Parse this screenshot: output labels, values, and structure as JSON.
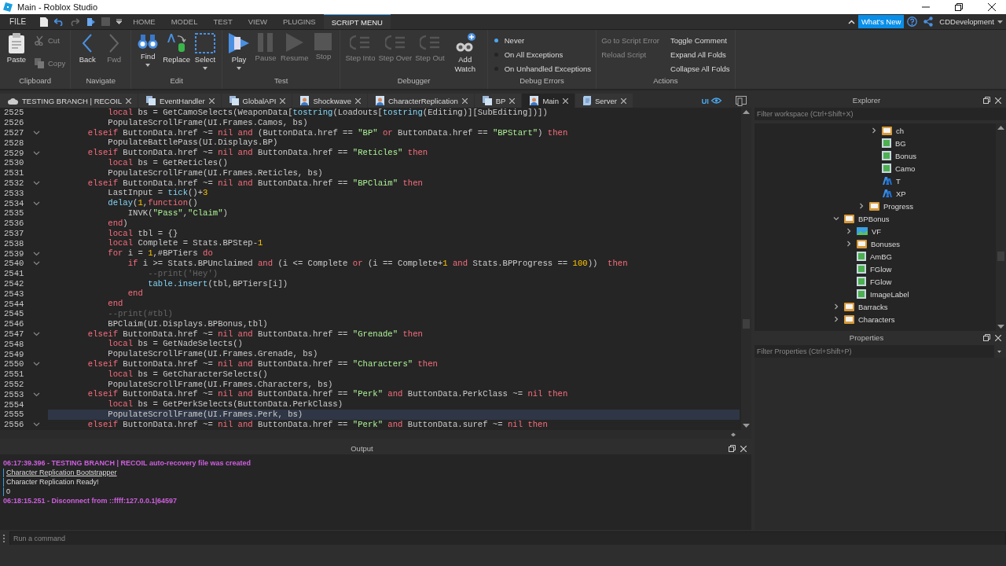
{
  "window": {
    "title": "Main - Roblox Studio"
  },
  "menu_bar": {
    "file": "FILE",
    "tabs": [
      {
        "label": "HOME",
        "selected": false
      },
      {
        "label": "MODEL",
        "selected": false
      },
      {
        "label": "TEST",
        "selected": false
      },
      {
        "label": "VIEW",
        "selected": false
      },
      {
        "label": "PLUGINS",
        "selected": false
      },
      {
        "label": "SCRIPT MENU",
        "selected": true
      }
    ],
    "whats_new": "What's New",
    "user": "CDDevelopment"
  },
  "ribbon": [
    {
      "label": "Clipboard",
      "items": [
        {
          "kind": "large",
          "label": "Paste",
          "disabled": false
        },
        {
          "kind": "small",
          "label": "Cut",
          "disabled": true
        },
        {
          "kind": "small",
          "label": "Copy",
          "disabled": true
        }
      ]
    },
    {
      "label": "Navigate",
      "items": [
        {
          "kind": "large",
          "label": "Back",
          "disabled": false
        },
        {
          "kind": "large",
          "label": "Fwd",
          "disabled": true
        }
      ]
    },
    {
      "label": "Edit",
      "items": [
        {
          "kind": "large",
          "label": "Find",
          "disabled": false,
          "dropdown": true
        },
        {
          "kind": "large",
          "label": "Replace",
          "disabled": false,
          "dropdown": false
        },
        {
          "kind": "large",
          "label": "Select",
          "disabled": false,
          "dropdown": true
        }
      ]
    },
    {
      "label": "Test",
      "items": [
        {
          "kind": "large",
          "label": "Play",
          "disabled": false,
          "dropdown": true
        },
        {
          "kind": "large",
          "label": "Pause",
          "disabled": true
        },
        {
          "kind": "large",
          "label": "Resume",
          "disabled": true
        },
        {
          "kind": "large",
          "label": "Stop",
          "disabled": true
        }
      ]
    },
    {
      "label": "Debugger",
      "items": [
        {
          "kind": "large",
          "label": "Step Into",
          "disabled": true
        },
        {
          "kind": "large",
          "label": "Step Over",
          "disabled": true
        },
        {
          "kind": "large",
          "label": "Step Out",
          "disabled": true
        },
        {
          "kind": "large",
          "label": "Add Watch",
          "disabled": false
        }
      ]
    },
    {
      "label": "Debug Errors",
      "items": [
        {
          "kind": "radio",
          "label": "Never",
          "selected": true
        },
        {
          "kind": "radio",
          "label": "On All Exceptions",
          "selected": false
        },
        {
          "kind": "radio",
          "label": "On Unhandled Exceptions",
          "selected": false
        }
      ]
    },
    {
      "label": "Actions",
      "items": [
        {
          "kind": "link",
          "label": "Go to Script Error",
          "disabled": true
        },
        {
          "kind": "link",
          "label": "Reload Script",
          "disabled": true
        },
        {
          "kind": "link",
          "label": "Toggle Comment",
          "disabled": false
        },
        {
          "kind": "link",
          "label": "Expand All Folds",
          "disabled": false
        },
        {
          "kind": "link",
          "label": "Collapse All Folds",
          "disabled": false
        }
      ]
    }
  ],
  "doc_tabs": [
    {
      "label": "TESTING BRANCH | RECOIL",
      "selected": false
    },
    {
      "label": "EventHandler",
      "selected": false
    },
    {
      "label": "GlobalAPI",
      "selected": false
    },
    {
      "label": "Shockwave",
      "selected": false
    },
    {
      "label": "CharacterReplication",
      "selected": false
    },
    {
      "label": "BP",
      "selected": false
    },
    {
      "label": "Main",
      "selected": true
    },
    {
      "label": "Server",
      "selected": false
    }
  ],
  "ui_toggle": "UI",
  "code": {
    "lines": [
      {
        "number": "2525",
        "fold": false,
        "selected": false,
        "tokens": [
          {
            "kind": "kw",
            "text": "            local"
          },
          {
            "kind": "p",
            "text": " bs = GetCamoSelects(WeaponData["
          },
          {
            "kind": "bi",
            "text": "tostring"
          },
          {
            "kind": "p",
            "text": "(Loadouts["
          },
          {
            "kind": "bi",
            "text": "tostring"
          },
          {
            "kind": "p",
            "text": "(Editing)][SubEditing])])"
          }
        ]
      },
      {
        "number": "2526",
        "fold": false,
        "selected": false,
        "tokens": [
          {
            "kind": "p",
            "text": "            PopulateScrollFrame(UI.Frames.Camos, bs)"
          }
        ]
      },
      {
        "number": "2527",
        "fold": true,
        "selected": false,
        "tokens": [
          {
            "kind": "kw",
            "text": "        elseif"
          },
          {
            "kind": "p",
            "text": " ButtonData.href ~= "
          },
          {
            "kind": "kw",
            "text": "nil and"
          },
          {
            "kind": "p",
            "text": " (ButtonData.href == "
          },
          {
            "kind": "st",
            "text": "\"BP\""
          },
          {
            "kind": "kw",
            "text": " or"
          },
          {
            "kind": "p",
            "text": " ButtonData.href == "
          },
          {
            "kind": "st",
            "text": "\"BPStart\""
          },
          {
            "kind": "p",
            "text": ") "
          },
          {
            "kind": "kw",
            "text": "then"
          }
        ]
      },
      {
        "number": "2528",
        "fold": false,
        "selected": false,
        "tokens": [
          {
            "kind": "p",
            "text": "            PopulateBattlePass(UI.Displays.BP)"
          }
        ]
      },
      {
        "number": "2529",
        "fold": true,
        "selected": false,
        "tokens": [
          {
            "kind": "kw",
            "text": "        elseif"
          },
          {
            "kind": "p",
            "text": " ButtonData.href ~= "
          },
          {
            "kind": "kw",
            "text": "nil and"
          },
          {
            "kind": "p",
            "text": " ButtonData.href == "
          },
          {
            "kind": "st",
            "text": "\"Reticles\""
          },
          {
            "kind": "kw",
            "text": " then"
          }
        ]
      },
      {
        "number": "2530",
        "fold": false,
        "selected": false,
        "tokens": [
          {
            "kind": "kw",
            "text": "            local"
          },
          {
            "kind": "p",
            "text": " bs = GetReticles()"
          }
        ]
      },
      {
        "number": "2531",
        "fold": false,
        "selected": false,
        "tokens": [
          {
            "kind": "p",
            "text": "            PopulateScrollFrame(UI.Frames.Reticles, bs)"
          }
        ]
      },
      {
        "number": "2532",
        "fold": true,
        "selected": false,
        "tokens": [
          {
            "kind": "kw",
            "text": "        elseif"
          },
          {
            "kind": "p",
            "text": " ButtonData.href ~= "
          },
          {
            "kind": "kw",
            "text": "nil and"
          },
          {
            "kind": "p",
            "text": " ButtonData.href == "
          },
          {
            "kind": "st",
            "text": "\"BPClaim\""
          },
          {
            "kind": "kw",
            "text": " then"
          }
        ]
      },
      {
        "number": "2533",
        "fold": false,
        "selected": false,
        "tokens": [
          {
            "kind": "p",
            "text": "            LastInput = "
          },
          {
            "kind": "bi",
            "text": "tick"
          },
          {
            "kind": "p",
            "text": "()+"
          },
          {
            "kind": "nu",
            "text": "3"
          }
        ]
      },
      {
        "number": "2534",
        "fold": true,
        "selected": false,
        "tokens": [
          {
            "kind": "bi",
            "text": "            delay"
          },
          {
            "kind": "p",
            "text": "("
          },
          {
            "kind": "nu",
            "text": "1"
          },
          {
            "kind": "p",
            "text": ","
          },
          {
            "kind": "kw",
            "text": "function"
          },
          {
            "kind": "p",
            "text": "()"
          }
        ]
      },
      {
        "number": "2535",
        "fold": false,
        "selected": false,
        "tokens": [
          {
            "kind": "p",
            "text": "                INVK("
          },
          {
            "kind": "st",
            "text": "\"Pass\""
          },
          {
            "kind": "p",
            "text": ","
          },
          {
            "kind": "st",
            "text": "\"Claim\""
          },
          {
            "kind": "p",
            "text": ")"
          }
        ]
      },
      {
        "number": "2536",
        "fold": false,
        "selected": false,
        "tokens": [
          {
            "kind": "kw",
            "text": "            end"
          },
          {
            "kind": "p",
            "text": ")"
          }
        ]
      },
      {
        "number": "2537",
        "fold": false,
        "selected": false,
        "tokens": [
          {
            "kind": "kw",
            "text": "            local"
          },
          {
            "kind": "p",
            "text": " tbl = {}"
          }
        ]
      },
      {
        "number": "2538",
        "fold": false,
        "selected": false,
        "tokens": [
          {
            "kind": "kw",
            "text": "            local"
          },
          {
            "kind": "p",
            "text": " Complete = Stats.BPStep-"
          },
          {
            "kind": "nu",
            "text": "1"
          }
        ]
      },
      {
        "number": "2539",
        "fold": true,
        "selected": false,
        "tokens": [
          {
            "kind": "kw",
            "text": "            for"
          },
          {
            "kind": "p",
            "text": " i = "
          },
          {
            "kind": "nu",
            "text": "1"
          },
          {
            "kind": "p",
            "text": ",#BPTiers "
          },
          {
            "kind": "kw",
            "text": "do"
          }
        ]
      },
      {
        "number": "2540",
        "fold": true,
        "selected": false,
        "tokens": [
          {
            "kind": "kw",
            "text": "                if"
          },
          {
            "kind": "p",
            "text": " i >= Stats.BPUnclaimed "
          },
          {
            "kind": "kw",
            "text": "and"
          },
          {
            "kind": "p",
            "text": " (i <= Complete "
          },
          {
            "kind": "kw",
            "text": "or"
          },
          {
            "kind": "p",
            "text": " (i == Complete+"
          },
          {
            "kind": "nu",
            "text": "1"
          },
          {
            "kind": "kw",
            "text": " and"
          },
          {
            "kind": "p",
            "text": " Stats.BPProgress == "
          },
          {
            "kind": "nu",
            "text": "100"
          },
          {
            "kind": "p",
            "text": "))  "
          },
          {
            "kind": "kw",
            "text": "then"
          }
        ]
      },
      {
        "number": "2541",
        "fold": false,
        "selected": false,
        "tokens": [
          {
            "kind": "cm",
            "text": "                    --print('Hey')"
          }
        ]
      },
      {
        "number": "2542",
        "fold": false,
        "selected": false,
        "tokens": [
          {
            "kind": "bi",
            "text": "                    table.insert"
          },
          {
            "kind": "p",
            "text": "(tbl,BPTiers[i])"
          }
        ]
      },
      {
        "number": "2543",
        "fold": false,
        "selected": false,
        "tokens": [
          {
            "kind": "kw",
            "text": "                end"
          }
        ]
      },
      {
        "number": "2544",
        "fold": false,
        "selected": false,
        "tokens": [
          {
            "kind": "kw",
            "text": "            end"
          }
        ]
      },
      {
        "number": "2545",
        "fold": false,
        "selected": false,
        "tokens": [
          {
            "kind": "cm",
            "text": "            --print(#tbl)"
          }
        ]
      },
      {
        "number": "2546",
        "fold": false,
        "selected": false,
        "tokens": [
          {
            "kind": "p",
            "text": "            BPClaim(UI.Displays.BPBonus,tbl)"
          }
        ]
      },
      {
        "number": "2547",
        "fold": true,
        "selected": false,
        "tokens": [
          {
            "kind": "kw",
            "text": "        elseif"
          },
          {
            "kind": "p",
            "text": " ButtonData.href ~= "
          },
          {
            "kind": "kw",
            "text": "nil and"
          },
          {
            "kind": "p",
            "text": " ButtonData.href == "
          },
          {
            "kind": "st",
            "text": "\"Grenade\""
          },
          {
            "kind": "kw",
            "text": " then"
          }
        ]
      },
      {
        "number": "2548",
        "fold": false,
        "selected": false,
        "tokens": [
          {
            "kind": "kw",
            "text": "            local"
          },
          {
            "kind": "p",
            "text": " bs = GetNadeSelects()"
          }
        ]
      },
      {
        "number": "2549",
        "fold": false,
        "selected": false,
        "tokens": [
          {
            "kind": "p",
            "text": "            PopulateScrollFrame(UI.Frames.Grenade, bs)"
          }
        ]
      },
      {
        "number": "2550",
        "fold": true,
        "selected": false,
        "tokens": [
          {
            "kind": "kw",
            "text": "        elseif"
          },
          {
            "kind": "p",
            "text": " ButtonData.href ~= "
          },
          {
            "kind": "kw",
            "text": "nil and"
          },
          {
            "kind": "p",
            "text": " ButtonData.href == "
          },
          {
            "kind": "st",
            "text": "\"Characters\""
          },
          {
            "kind": "kw",
            "text": " then"
          }
        ]
      },
      {
        "number": "2551",
        "fold": false,
        "selected": false,
        "tokens": [
          {
            "kind": "kw",
            "text": "            local"
          },
          {
            "kind": "p",
            "text": " bs = GetCharacterSelects()"
          }
        ]
      },
      {
        "number": "2552",
        "fold": false,
        "selected": false,
        "tokens": [
          {
            "kind": "p",
            "text": "            PopulateScrollFrame(UI.Frames.Characters, bs)"
          }
        ]
      },
      {
        "number": "2553",
        "fold": true,
        "selected": false,
        "tokens": [
          {
            "kind": "kw",
            "text": "        elseif"
          },
          {
            "kind": "p",
            "text": " ButtonData.href ~= "
          },
          {
            "kind": "kw",
            "text": "nil and"
          },
          {
            "kind": "p",
            "text": " ButtonData.href == "
          },
          {
            "kind": "st",
            "text": "\"Perk\""
          },
          {
            "kind": "kw",
            "text": " and"
          },
          {
            "kind": "p",
            "text": " ButtonData.PerkClass ~= "
          },
          {
            "kind": "kw",
            "text": "nil then"
          }
        ]
      },
      {
        "number": "2554",
        "fold": false,
        "selected": false,
        "tokens": [
          {
            "kind": "kw",
            "text": "            local"
          },
          {
            "kind": "p",
            "text": " bs = GetPerkSelects(ButtonData.PerkClass)"
          }
        ]
      },
      {
        "number": "2555",
        "fold": false,
        "selected": true,
        "tokens": [
          {
            "kind": "p",
            "text": "            PopulateScrollFrame(UI.Frames.Perk, bs)"
          }
        ]
      },
      {
        "number": "2556",
        "fold": true,
        "selected": false,
        "tokens": [
          {
            "kind": "kw",
            "text": "        elseif"
          },
          {
            "kind": "p",
            "text": " ButtonData.href ~= "
          },
          {
            "kind": "kw",
            "text": "nil and"
          },
          {
            "kind": "p",
            "text": " ButtonData.href == "
          },
          {
            "kind": "st",
            "text": "\"Perk\""
          },
          {
            "kind": "kw",
            "text": " and"
          },
          {
            "kind": "p",
            "text": " ButtonData.suref ~= "
          },
          {
            "kind": "kw",
            "text": "nil then"
          }
        ]
      }
    ]
  },
  "explorer": {
    "title": "Explorer",
    "placeholder": "Filter workspace (Ctrl+Shift+X)",
    "tree": [
      {
        "children": [
          {
            "children": [
              {
                "children": [
                  {
                    "label": "ch",
                    "kind": "frame",
                    "expanded": false
                  },
                  {
                    "label": "BG",
                    "kind": "image"
                  },
                  {
                    "label": "Bonus",
                    "kind": "image"
                  },
                  {
                    "label": "Camo",
                    "kind": "image"
                  },
                  {
                    "label": "T",
                    "kind": "text"
                  },
                  {
                    "label": "XP",
                    "kind": "text"
                  }
                ]
              },
              {
                "label": "Progress",
                "kind": "frame",
                "expanded": false
              }
            ]
          }
        ]
      },
      {
        "label": "BPBonus",
        "kind": "frame",
        "expanded": true,
        "children": [
          {
            "label": "VF",
            "kind": "viewport",
            "expanded": false
          },
          {
            "label": "Bonuses",
            "kind": "frame",
            "expanded": false
          },
          {
            "label": "AmBG",
            "kind": "image"
          },
          {
            "label": "FGlow",
            "kind": "image"
          },
          {
            "label": "FGlow",
            "kind": "image"
          },
          {
            "label": "ImageLabel",
            "kind": "image"
          }
        ]
      },
      {
        "label": "Barracks",
        "kind": "frame",
        "expanded": false
      },
      {
        "label": "Characters",
        "kind": "frame",
        "expanded": false
      }
    ]
  },
  "properties": {
    "title": "Properties",
    "placeholder": "Filter Properties (Ctrl+Shift+P)"
  },
  "output": {
    "title": "Output",
    "lines": [
      {
        "kind": "system",
        "text": "06:17:39.396 - TESTING BRANCH | RECOIL auto-recovery file was created"
      },
      {
        "kind": "link",
        "text": "Character Replication Bootstrapper"
      },
      {
        "kind": "print",
        "text": "Character Replication Ready!"
      },
      {
        "kind": "print",
        "text": "0"
      },
      {
        "kind": "system",
        "text": "06:18:15.251 - Disconnect from ::ffff:127.0.0.1|64597"
      }
    ]
  },
  "command_bar": {
    "placeholder": "Run a command"
  }
}
